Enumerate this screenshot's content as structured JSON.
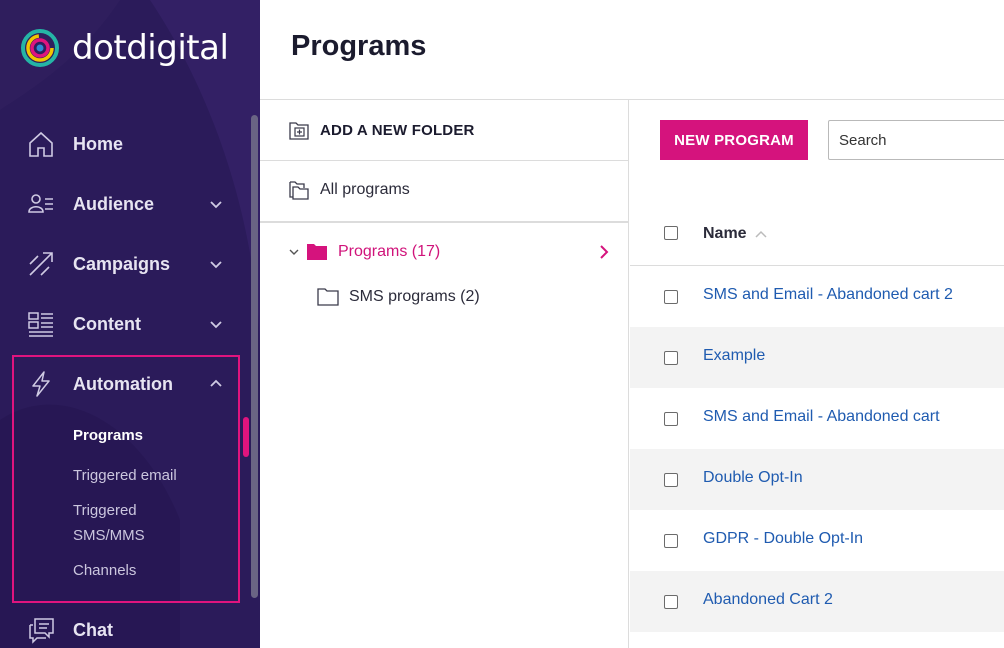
{
  "brand": {
    "name": "dotdigital",
    "accent": "#e0147e",
    "sidebar_bg": "#2b1b5a"
  },
  "sidebar": {
    "items": [
      {
        "label": "Home",
        "icon": "home-icon",
        "expandable": false
      },
      {
        "label": "Audience",
        "icon": "audience-icon",
        "expandable": true
      },
      {
        "label": "Campaigns",
        "icon": "campaigns-icon",
        "expandable": true
      },
      {
        "label": "Content",
        "icon": "content-icon",
        "expandable": true
      },
      {
        "label": "Automation",
        "icon": "lightning-icon",
        "expandable": true,
        "expanded": true
      },
      {
        "label": "Chat",
        "icon": "chat-icon",
        "expandable": false
      }
    ],
    "automation_sub": [
      {
        "label": "Programs",
        "active": true
      },
      {
        "label": "Triggered email",
        "active": false
      },
      {
        "label": "Triggered\nSMS/MMS",
        "active": false
      },
      {
        "label": "Channels",
        "active": false
      }
    ]
  },
  "page": {
    "title": "Programs"
  },
  "folders": {
    "add_folder_label": "ADD A NEW FOLDER",
    "all_programs_label": "All programs",
    "tree": [
      {
        "label": "Programs (17)",
        "selected": true,
        "expanded": true
      },
      {
        "label": "SMS programs (2)",
        "selected": false
      }
    ]
  },
  "toolbar": {
    "new_program_label": "NEW PROGRAM",
    "search_placeholder": "Search"
  },
  "table": {
    "columns": [
      {
        "label": "Name",
        "sort": "ascending"
      }
    ],
    "rows": [
      {
        "name": "SMS and Email - Abandoned cart 2"
      },
      {
        "name": "Example"
      },
      {
        "name": "SMS and Email - Abandoned cart"
      },
      {
        "name": "Double Opt-In"
      },
      {
        "name": "GDPR - Double Opt-In"
      },
      {
        "name": "Abandoned Cart 2"
      }
    ]
  }
}
